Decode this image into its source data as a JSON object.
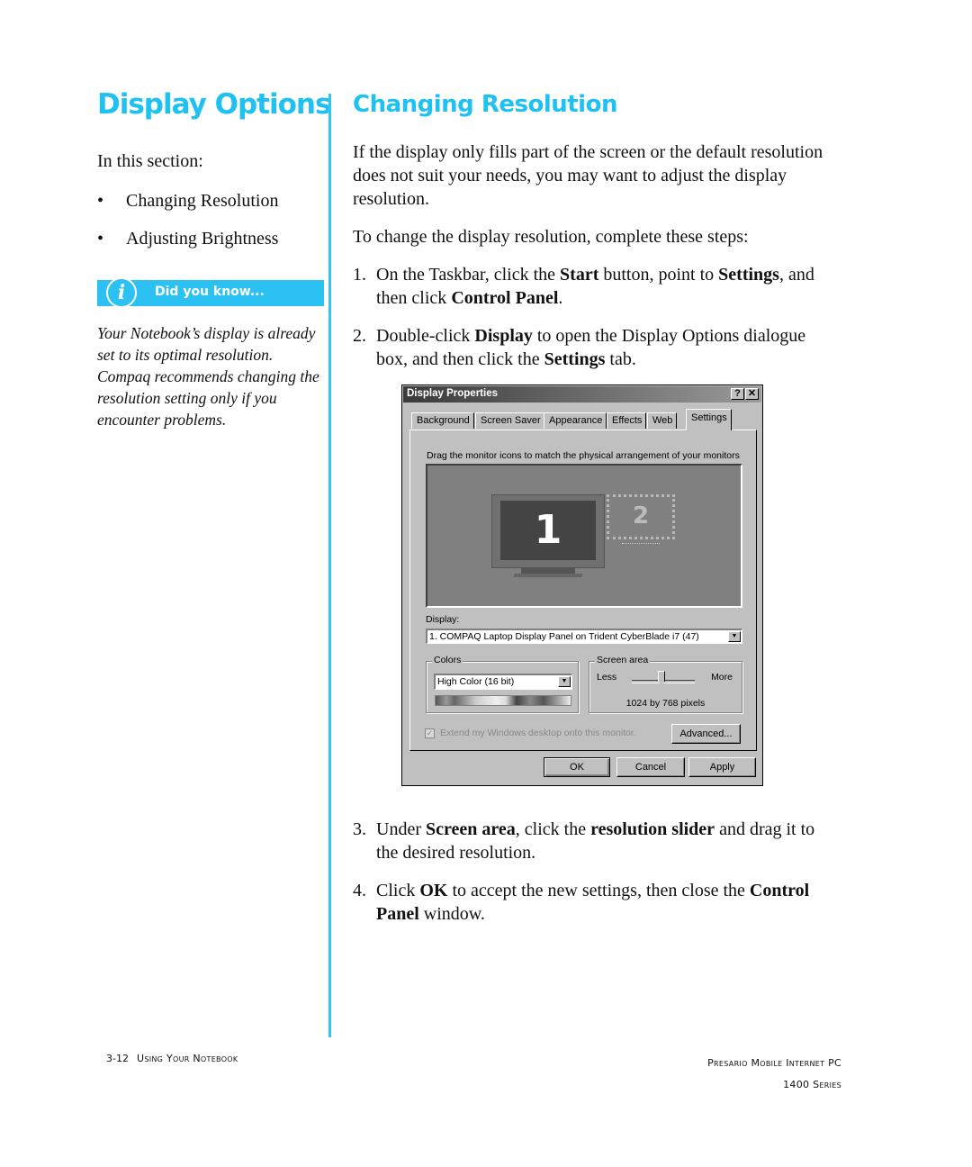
{
  "header": {
    "section_title": "Display Options",
    "page_title": "Changing Resolution"
  },
  "sidebar": {
    "intro": "In this section:",
    "items": [
      {
        "bullet": "•",
        "label": "Changing Resolution"
      },
      {
        "bullet": "•",
        "label": "Adjusting Brightness"
      }
    ],
    "did_you_know": {
      "icon": "info-icon",
      "icon_glyph": "i",
      "label": "Did you know..."
    },
    "tip": "Your Notebook’s display is already set to its optimal resolution. Compaq recommends changing the resolution setting only if you encounter problems."
  },
  "main": {
    "intro": "If the display only fills part of the screen or the default resolution does not suit your needs, you may want to adjust the display resolution.",
    "steps_intro": "To change the display resolution, complete these steps:",
    "steps": [
      {
        "num": "1.",
        "parts": [
          {
            "t": "On the Taskbar, click the ",
            "b": false
          },
          {
            "t": "Start",
            "b": true
          },
          {
            "t": " button, point to ",
            "b": false
          },
          {
            "t": "Settings",
            "b": true
          },
          {
            "t": ", and then click ",
            "b": false
          },
          {
            "t": "Control Panel",
            "b": true
          },
          {
            "t": ".",
            "b": false
          }
        ]
      },
      {
        "num": "2.",
        "parts": [
          {
            "t": "Double-click ",
            "b": false
          },
          {
            "t": "Display",
            "b": true
          },
          {
            "t": " to open the Display Options dialogue box, and then click the ",
            "b": false
          },
          {
            "t": "Settings",
            "b": true
          },
          {
            "t": " tab.",
            "b": false
          }
        ]
      },
      {
        "num": "3.",
        "parts": [
          {
            "t": "Under ",
            "b": false
          },
          {
            "t": "Screen area",
            "b": true
          },
          {
            "t": ", click the ",
            "b": false
          },
          {
            "t": "resolution slider",
            "b": true
          },
          {
            "t": " and drag it to the desired resolution.",
            "b": false
          }
        ]
      },
      {
        "num": "4.",
        "parts": [
          {
            "t": "Click ",
            "b": false
          },
          {
            "t": "OK",
            "b": true
          },
          {
            "t": " to accept the new settings, then close the ",
            "b": false
          },
          {
            "t": "Control Panel",
            "b": true
          },
          {
            "t": " window.",
            "b": false
          }
        ]
      }
    ]
  },
  "dialog": {
    "title": "Display Properties",
    "help_button": "?",
    "close_button": "✕",
    "tabs": [
      "Background",
      "Screen Saver",
      "Appearance",
      "Effects",
      "Web",
      "Settings"
    ],
    "active_tab": "Settings",
    "instruction": "Drag the monitor icons to match the physical arrangement of your monitors",
    "monitor1_label": "1",
    "monitor2_label": "2",
    "display_label": "Display:",
    "display_value": "1. COMPAQ Laptop Display Panel on Trident CyberBlade i7 (47)",
    "colors_legend": "Colors",
    "colors_value": "High Color (16 bit)",
    "screen_area_legend": "Screen area",
    "slider_less": "Less",
    "slider_more": "More",
    "slider_position_fraction": 0.5,
    "resolution_text": "1024 by 768 pixels",
    "extend_checkbox_label": "Extend my Windows desktop onto this monitor.",
    "extend_checked": true,
    "advanced_button": "Advanced...",
    "ok_button": "OK",
    "cancel_button": "Cancel",
    "apply_button": "Apply",
    "dropdown_arrow": "▼"
  },
  "footer": {
    "page_number": "3-12",
    "chapter": "Using Your Notebook",
    "product_line1": "Presario Mobile Internet PC",
    "product_line2": "1400 Series"
  },
  "colors": {
    "accent": "#1fc0f2",
    "callout_bg": "#2cc1f3",
    "dialog_gray": "#c0c0c0"
  }
}
